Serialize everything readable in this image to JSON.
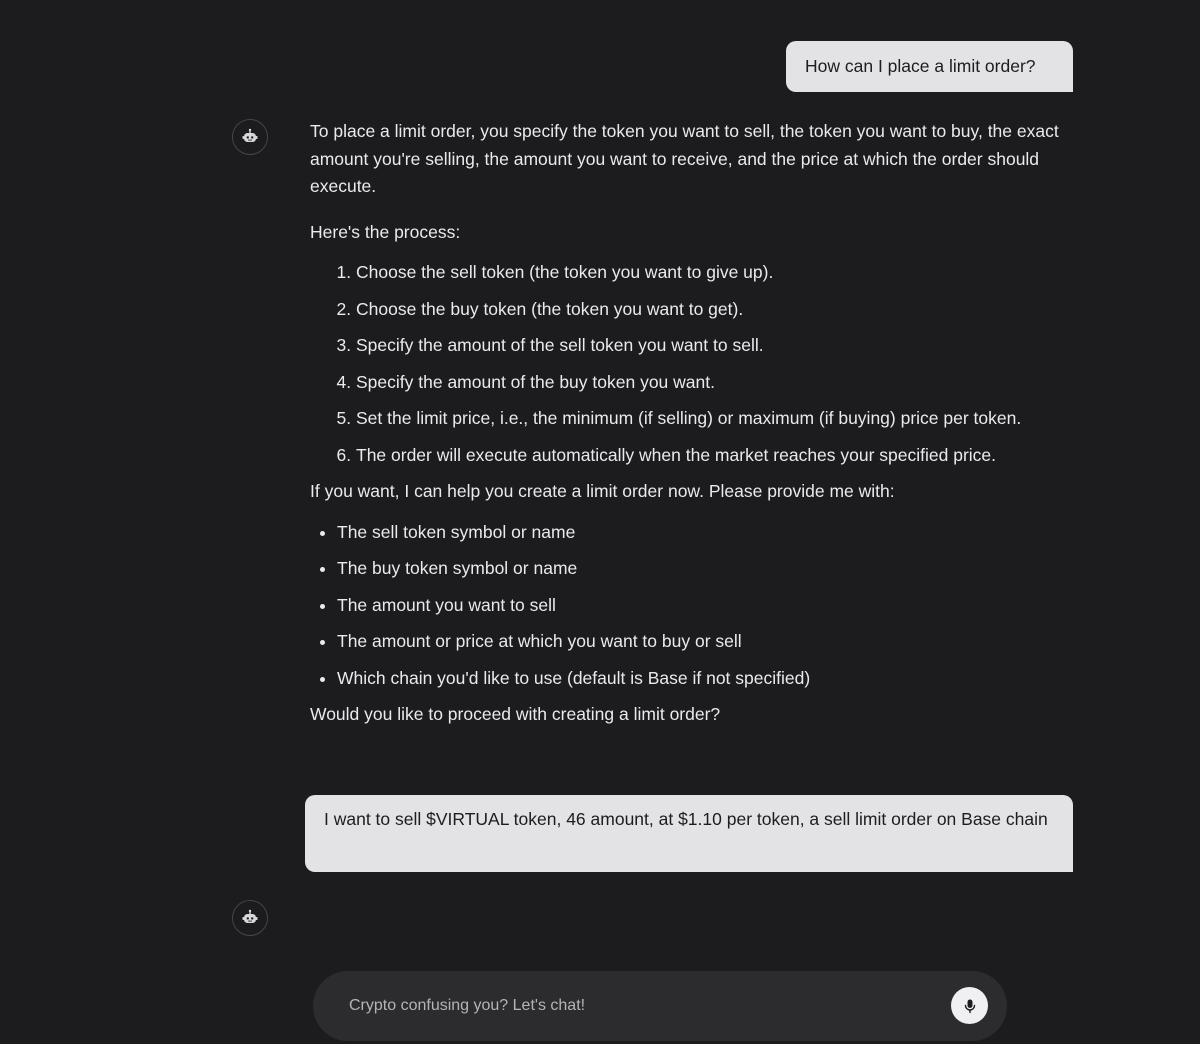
{
  "conversation": {
    "user_message_1": "How can I place a limit order?",
    "bot_reply": {
      "intro": "To place a limit order, you specify the token you want to sell, the token you want to buy, the exact amount you're selling, the amount you want to receive, and the price at which the order should execute.",
      "process_heading": "Here's the process:",
      "steps": [
        "Choose the sell token (the token you want to give up).",
        "Choose the buy token (the token you want to get).",
        "Specify the amount of the sell token you want to sell.",
        "Specify the amount of the buy token you want.",
        "Set the limit price, i.e., the minimum (if selling) or maximum (if buying) price per token.",
        "The order will execute automatically when the market reaches your specified price."
      ],
      "offer": "If you want, I can help you create a limit order now. Please provide me with:",
      "needs": [
        "The sell token symbol or name",
        "The buy token symbol or name",
        "The amount you want to sell",
        "The amount or price at which you want to buy or sell",
        "Which chain you'd like to use (default is Base if not specified)"
      ],
      "question": "Would you like to proceed with creating a limit order?"
    },
    "user_message_2": "I want to sell $VIRTUAL token, 46 amount, at $1.10 per token, a sell limit order on Base chain"
  },
  "composer": {
    "placeholder": "Crypto confusing you? Let's chat!",
    "mic_icon": "microphone-icon"
  },
  "icons": {
    "bot_avatar": "robot-icon"
  },
  "colors": {
    "background": "#1c1c1e",
    "user_bubble": "#e3e3e6",
    "composer": "#2c2c2f",
    "text": "#eaeaea"
  }
}
